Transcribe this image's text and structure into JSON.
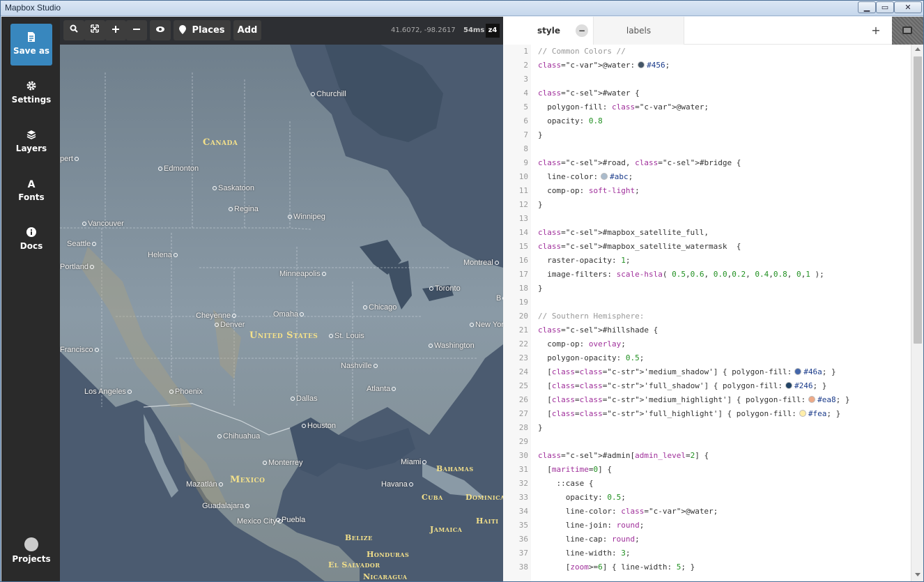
{
  "window": {
    "title": "Mapbox Studio",
    "min": "▁",
    "max": "▭",
    "close": "✕"
  },
  "sidebar": {
    "items": [
      {
        "label": "Save as",
        "icon": "document-icon"
      },
      {
        "label": "Settings",
        "icon": "gear-icon"
      },
      {
        "label": "Layers",
        "icon": "layers-icon"
      },
      {
        "label": "Fonts",
        "icon": "font-icon"
      },
      {
        "label": "Docs",
        "icon": "info-icon"
      }
    ],
    "projects_label": "Projects",
    "accent": "#3887be"
  },
  "toolbar": {
    "places_label": "Places",
    "add_label": "Add",
    "coords": "41.6072, -98.2617",
    "render_time": "54ms",
    "zoom": "z4"
  },
  "map": {
    "countries": [
      {
        "name": "Canada"
      },
      {
        "name": "United States"
      },
      {
        "name": "Mexico"
      },
      {
        "name": "Bahamas"
      },
      {
        "name": "Cuba"
      },
      {
        "name": "Dominica"
      },
      {
        "name": "Haiti"
      },
      {
        "name": "Jamaica"
      },
      {
        "name": "Belize"
      },
      {
        "name": "Honduras"
      },
      {
        "name": "El Salvador"
      },
      {
        "name": "Nicaragua"
      }
    ],
    "cities": [
      "Churchill",
      "Edmonton",
      "Saskatoon",
      "Regina",
      "Winnipeg",
      "Vancouver",
      "Seattle",
      "Helena",
      "Portland",
      "Minneapolis",
      "Montreal",
      "Toronto",
      "Chicago",
      "Cheyenne",
      "Denver",
      "Omaha",
      "New York",
      "Washington",
      "St. Louis",
      "Francisco",
      "Nashville",
      "Los Angeles",
      "Phoenix",
      "Atlanta",
      "Dallas",
      "Houston",
      "Chihuahua",
      "Monterrey",
      "Miami",
      "Havana",
      "Mazatlán",
      "Guadalajara",
      "Mexico City",
      "Puebla",
      "pert",
      "B"
    ]
  },
  "editor": {
    "tabs": [
      {
        "label": "style",
        "close": "−"
      },
      {
        "label": "labels"
      }
    ],
    "add_tab": "+",
    "lines": [
      {
        "n": "1",
        "t": "// Common Colors //"
      },
      {
        "n": "2",
        "t": "@water:",
        "hex": "#456"
      },
      {
        "n": "3",
        "t": ""
      },
      {
        "n": "4",
        "t": "#water {"
      },
      {
        "n": "5",
        "t": "  polygon-fill: @water;"
      },
      {
        "n": "6",
        "t": "  opacity: 0.8"
      },
      {
        "n": "7",
        "t": "}"
      },
      {
        "n": "8",
        "t": ""
      },
      {
        "n": "9",
        "t": "#road, #bridge {"
      },
      {
        "n": "10",
        "t": "  line-color:",
        "hex": "#abc"
      },
      {
        "n": "11",
        "t": "  comp-op: soft-light;"
      },
      {
        "n": "12",
        "t": "}"
      },
      {
        "n": "13",
        "t": ""
      },
      {
        "n": "14",
        "t": "#mapbox_satellite_full,"
      },
      {
        "n": "15",
        "t": "#mapbox_satellite_watermask  {"
      },
      {
        "n": "16",
        "t": "  raster-opacity: 1;"
      },
      {
        "n": "17",
        "t": "  image-filters: scale-hsla( 0.5,0.6, 0.0,0.2, 0.4,0.8, 0,1 );"
      },
      {
        "n": "18",
        "t": "}"
      },
      {
        "n": "19",
        "t": ""
      },
      {
        "n": "20",
        "t": "// Southern Hemisphere:"
      },
      {
        "n": "21",
        "t": "#hillshade {"
      },
      {
        "n": "22",
        "t": "  comp-op: overlay;"
      },
      {
        "n": "23",
        "t": "  polygon-opacity: 0.5;"
      },
      {
        "n": "24",
        "t": "  [class='medium_shadow'] { polygon-fill:",
        "hex": "#46a",
        "tail": "; }"
      },
      {
        "n": "25",
        "t": "  [class='full_shadow'] { polygon-fill:",
        "hex": "#246",
        "tail": "; }"
      },
      {
        "n": "26",
        "t": "  [class='medium_highlight'] { polygon-fill:",
        "hex": "#ea8",
        "tail": "; }"
      },
      {
        "n": "27",
        "t": "  [class='full_highlight'] { polygon-fill:",
        "hex": "#fea",
        "tail": "; }"
      },
      {
        "n": "28",
        "t": "}"
      },
      {
        "n": "29",
        "t": ""
      },
      {
        "n": "30",
        "t": "#admin[admin_level=2] {"
      },
      {
        "n": "31",
        "t": "  [maritime=0] {"
      },
      {
        "n": "32",
        "t": "    ::case {"
      },
      {
        "n": "33",
        "t": "      opacity: 0.5;"
      },
      {
        "n": "34",
        "t": "      line-color: @water;"
      },
      {
        "n": "35",
        "t": "      line-join: round;"
      },
      {
        "n": "36",
        "t": "      line-cap: round;"
      },
      {
        "n": "37",
        "t": "      line-width: 3;"
      },
      {
        "n": "38",
        "t": "      [zoom>=6] { line-width: 5; }"
      }
    ],
    "swatches": {
      "#456": "#445566",
      "#abc": "#aabbcc",
      "#46a": "#4466aa",
      "#246": "#224466",
      "#ea8": "#eeaa88",
      "#fea": "#ffeeaa"
    }
  }
}
